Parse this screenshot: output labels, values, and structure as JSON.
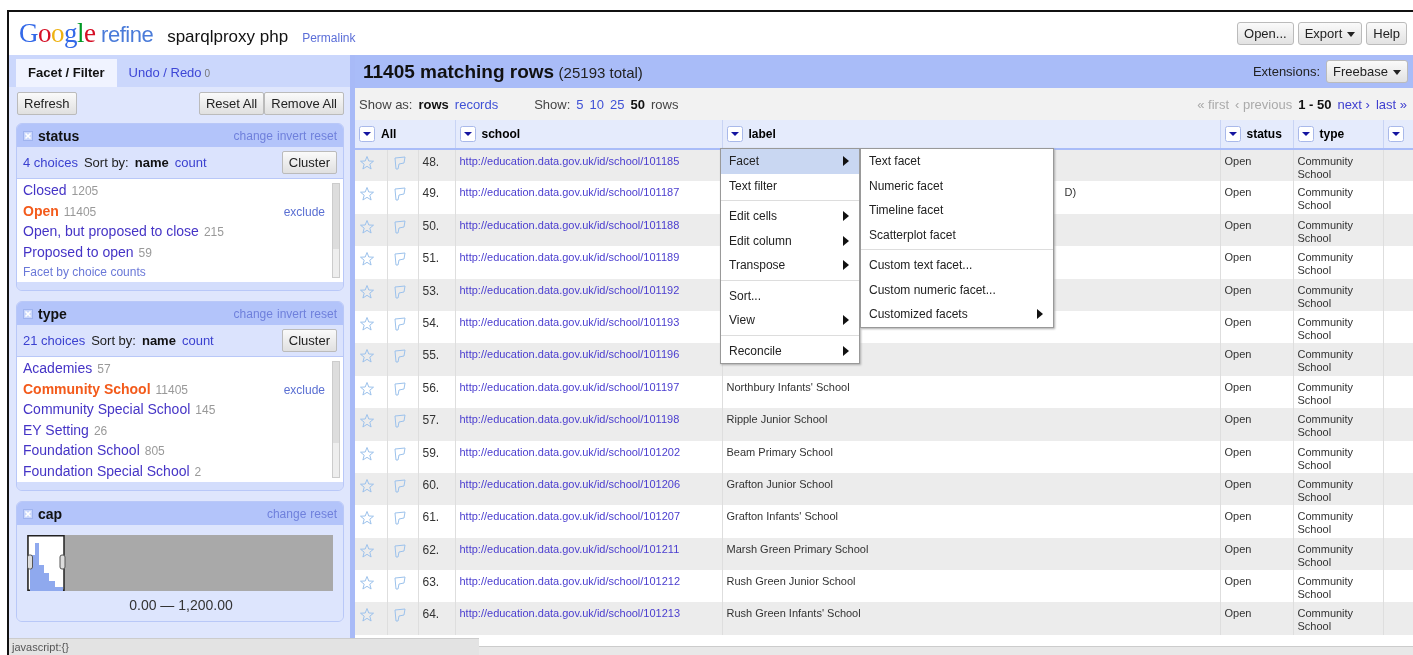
{
  "header": {
    "logo": "Google",
    "product": "refine",
    "project_name": "sparqlproxy php",
    "permalink": "Permalink",
    "buttons": [
      {
        "label": "Open...",
        "kind": "plain"
      },
      {
        "label": "Export",
        "kind": "dropdown"
      },
      {
        "label": "Help",
        "kind": "plain"
      }
    ]
  },
  "left_tabs": [
    {
      "label": "Facet / Filter",
      "selected": true
    },
    {
      "label": "Undo / Redo",
      "count": "0",
      "selected": false
    }
  ],
  "facet_toolbar": {
    "refresh": "Refresh",
    "buttons": [
      "Reset All",
      "Remove All"
    ]
  },
  "facets": [
    {
      "kind": "list",
      "title": "status",
      "actions": [
        "change",
        "invert",
        "reset"
      ],
      "choices_count": "4 choices",
      "sort_label": "Sort by:",
      "sort_options": [
        {
          "label": "name",
          "selected": true
        },
        {
          "label": "count",
          "selected": false
        }
      ],
      "cluster": "Cluster",
      "choices": [
        {
          "name": "Closed",
          "count": "1205",
          "selected": false
        },
        {
          "name": "Open",
          "count": "11405",
          "selected": true,
          "exclude": "exclude"
        },
        {
          "name": "Open, but proposed to close",
          "count": "215",
          "selected": false
        },
        {
          "name": "Proposed to open",
          "count": "59",
          "selected": false
        }
      ],
      "footer_link": "Facet by choice counts"
    },
    {
      "kind": "list",
      "title": "type",
      "actions": [
        "change",
        "invert",
        "reset"
      ],
      "choices_count": "21 choices",
      "sort_label": "Sort by:",
      "sort_options": [
        {
          "label": "name",
          "selected": true
        },
        {
          "label": "count",
          "selected": false
        }
      ],
      "cluster": "Cluster",
      "choices": [
        {
          "name": "Academies",
          "count": "57",
          "selected": false
        },
        {
          "name": "Community School",
          "count": "11405",
          "selected": true,
          "exclude": "exclude"
        },
        {
          "name": "Community Special School",
          "count": "145",
          "selected": false
        },
        {
          "name": "EY Setting",
          "count": "26",
          "selected": false
        },
        {
          "name": "Foundation School",
          "count": "805",
          "selected": false
        },
        {
          "name": "Foundation Special School",
          "count": "2",
          "selected": false
        }
      ]
    },
    {
      "kind": "range",
      "title": "cap",
      "actions": [
        "change",
        "reset"
      ],
      "range_label": "0.00 — 1,200.00"
    }
  ],
  "grid": {
    "title": "11405 matching rows",
    "total": "(25193 total)",
    "extensions_label": "Extensions:",
    "extensions_button": "Freebase",
    "show_as_label": "Show as:",
    "show_as": [
      {
        "label": "rows",
        "selected": true
      },
      {
        "label": "records",
        "selected": false
      }
    ],
    "show_label": "Show:",
    "page_sizes": [
      {
        "label": "5",
        "selected": false
      },
      {
        "label": "10",
        "selected": false
      },
      {
        "label": "25",
        "selected": false
      },
      {
        "label": "50",
        "selected": true
      }
    ],
    "page_sizes_suffix": "rows",
    "pager": [
      {
        "kind": "link",
        "label": "« first",
        "disabled": true
      },
      {
        "kind": "link",
        "label": "‹ previous",
        "disabled": true
      },
      {
        "kind": "range",
        "label": "1 - 50"
      },
      {
        "kind": "link",
        "label": "next ›",
        "disabled": false
      },
      {
        "kind": "link",
        "label": "last »",
        "disabled": false
      }
    ],
    "columns": [
      {
        "kind": "all",
        "label": "All"
      },
      {
        "kind": "data",
        "label": "school"
      },
      {
        "kind": "data",
        "label": "label"
      },
      {
        "kind": "data",
        "label": "status"
      },
      {
        "kind": "data",
        "label": "type"
      },
      {
        "kind": "partial"
      }
    ],
    "rows": [
      {
        "index": "48.",
        "school": "http://education.data.gov.uk/id/school/101185",
        "status": "Open",
        "type": "Community School"
      },
      {
        "index": "49.",
        "school": "http://education.data.gov.uk/id/school/101187",
        "label": "D)",
        "label_clipped": true,
        "status": "Open",
        "type": "Community School"
      },
      {
        "index": "50.",
        "school": "http://education.data.gov.uk/id/school/101188",
        "status": "Open",
        "type": "Community School"
      },
      {
        "index": "51.",
        "school": "http://education.data.gov.uk/id/school/101189",
        "status": "Open",
        "type": "Community School"
      },
      {
        "index": "53.",
        "school": "http://education.data.gov.uk/id/school/101192",
        "status": "Open",
        "type": "Community School"
      },
      {
        "index": "54.",
        "school": "http://education.data.gov.uk/id/school/101193",
        "status": "Open",
        "type": "Community School"
      },
      {
        "index": "55.",
        "school": "http://education.data.gov.uk/id/school/101196",
        "status": "Open",
        "type": "Community School"
      },
      {
        "index": "56.",
        "school": "http://education.data.gov.uk/id/school/101197",
        "label": "Northbury Infants' School",
        "status": "Open",
        "type": "Community School"
      },
      {
        "index": "57.",
        "school": "http://education.data.gov.uk/id/school/101198",
        "label": "Ripple Junior School",
        "status": "Open",
        "type": "Community School"
      },
      {
        "index": "59.",
        "school": "http://education.data.gov.uk/id/school/101202",
        "label": "Beam Primary School",
        "status": "Open",
        "type": "Community School"
      },
      {
        "index": "60.",
        "school": "http://education.data.gov.uk/id/school/101206",
        "label": "Grafton Junior School",
        "status": "Open",
        "type": "Community School"
      },
      {
        "index": "61.",
        "school": "http://education.data.gov.uk/id/school/101207",
        "label": "Grafton Infants' School",
        "status": "Open",
        "type": "Community School"
      },
      {
        "index": "62.",
        "school": "http://education.data.gov.uk/id/school/101211",
        "label": "Marsh Green Primary School",
        "status": "Open",
        "type": "Community School"
      },
      {
        "index": "63.",
        "school": "http://education.data.gov.uk/id/school/101212",
        "label": "Rush Green Junior School",
        "status": "Open",
        "type": "Community School"
      },
      {
        "index": "64.",
        "school": "http://education.data.gov.uk/id/school/101213",
        "label": "Rush Green Infants' School",
        "status": "Open",
        "type": "Community School"
      }
    ]
  },
  "context_menu": {
    "groups": [
      [
        {
          "label": "Facet",
          "submenu": true,
          "selected": true
        },
        {
          "label": "Text filter",
          "submenu": false,
          "selected": false
        }
      ],
      [
        {
          "label": "Edit cells",
          "submenu": true,
          "selected": false
        },
        {
          "label": "Edit column",
          "submenu": true,
          "selected": false
        },
        {
          "label": "Transpose",
          "submenu": true,
          "selected": false
        }
      ],
      [
        {
          "label": "Sort...",
          "submenu": false,
          "selected": false
        },
        {
          "label": "View",
          "submenu": true,
          "selected": false
        }
      ],
      [
        {
          "label": "Reconcile",
          "submenu": true,
          "selected": false
        }
      ]
    ]
  },
  "submenu": {
    "groups": [
      [
        {
          "label": "Text facet",
          "submenu": false,
          "selected": false
        },
        {
          "label": "Numeric facet",
          "submenu": false,
          "selected": false
        },
        {
          "label": "Timeline facet",
          "submenu": false,
          "selected": false
        },
        {
          "label": "Scatterplot facet",
          "submenu": false,
          "selected": false
        }
      ],
      [
        {
          "label": "Custom text facet...",
          "submenu": false,
          "selected": false
        },
        {
          "label": "Custom numeric facet...",
          "submenu": false,
          "selected": false
        },
        {
          "label": "Customized facets",
          "submenu": true,
          "selected": false
        }
      ]
    ]
  },
  "status_bar": "javascript:{}"
}
